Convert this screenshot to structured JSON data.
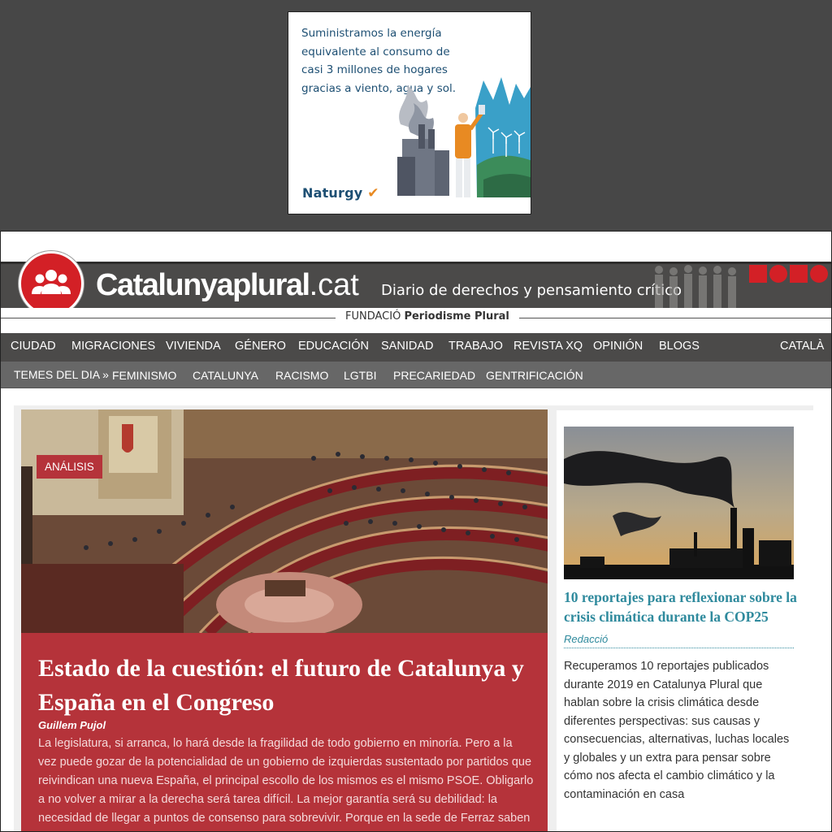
{
  "ad": {
    "text": "Suministramos la energía equivalente al consumo de casi 3 millones de hogares gracias a viento, agua y sol.",
    "brand": "Naturgy"
  },
  "site": {
    "brand_name": "Catalunyaplural",
    "brand_tld": ".cat",
    "tagline": "Diario de derechos y pensamiento crítico",
    "fundacio": "FUNDACIÓ",
    "fundacio_bold": "Periodisme Plural"
  },
  "main_nav": {
    "items": [
      "CIUDAD",
      "MIGRACIONES",
      "VIVIENDA",
      "GÉNERO",
      "EDUCACIÓN",
      "SANIDAD",
      "TRABAJO",
      "REVISTA XQ",
      "OPINIÓN",
      "BLOGS"
    ],
    "language": "CATALÀ"
  },
  "topics_nav": {
    "label": "TEMES DEL DIA »",
    "items": [
      "FEMINISMO",
      "CATALUNYA",
      "RACISMO",
      "LGTBI",
      "PRECARIEDAD",
      "GENTRIFICACIÓN"
    ]
  },
  "feature": {
    "category": "ANÁLISIS",
    "title": "Estado de la cuestión: el futuro de Catalunya y España en el Congreso",
    "author": "Guillem Pujol",
    "excerpt": "La legislatura, si arranca, lo hará desde la fragilidad de todo gobierno en minoría. Pero a la vez puede gozar de la potencialidad de un gobierno de izquierdas sustentado por partidos que reivindican una nueva España, el principal escollo de los mismos es el mismo PSOE. Obligarlo a no volver a mirar a la derecha será tarea difícil. La mejor garantía será su debilidad: la necesidad de llegar a puntos de consenso para sobrevivir. Porque en la sede de Ferraz saben que otra legislatura que acabe antes de tiempo les pasaría factura."
  },
  "side_story": {
    "title": "10 reportajes para reflexionar sobre la crisis climática durante la COP25",
    "author": "Redacció",
    "excerpt": "Recuperamos 10 reportajes publicados durante 2019 en Catalunya Plural que hablan sobre la crisis climática desde diferentes perspectivas: sus causas y consecuencias, alternativas, luchas locales y globales y un extra para pensar sobre cómo nos afecta el cambio climático y la contaminación en casa"
  },
  "colors": {
    "page_background": "#474747",
    "nav_background": "#4b4a49",
    "brand_red": "#d32026",
    "feature_red": "#b5333a",
    "link_teal": "#2f8a9d",
    "ad_text_blue": "#1d4f73"
  },
  "icons": [
    "people-group-icon",
    "naturgy-flame-icon"
  ]
}
